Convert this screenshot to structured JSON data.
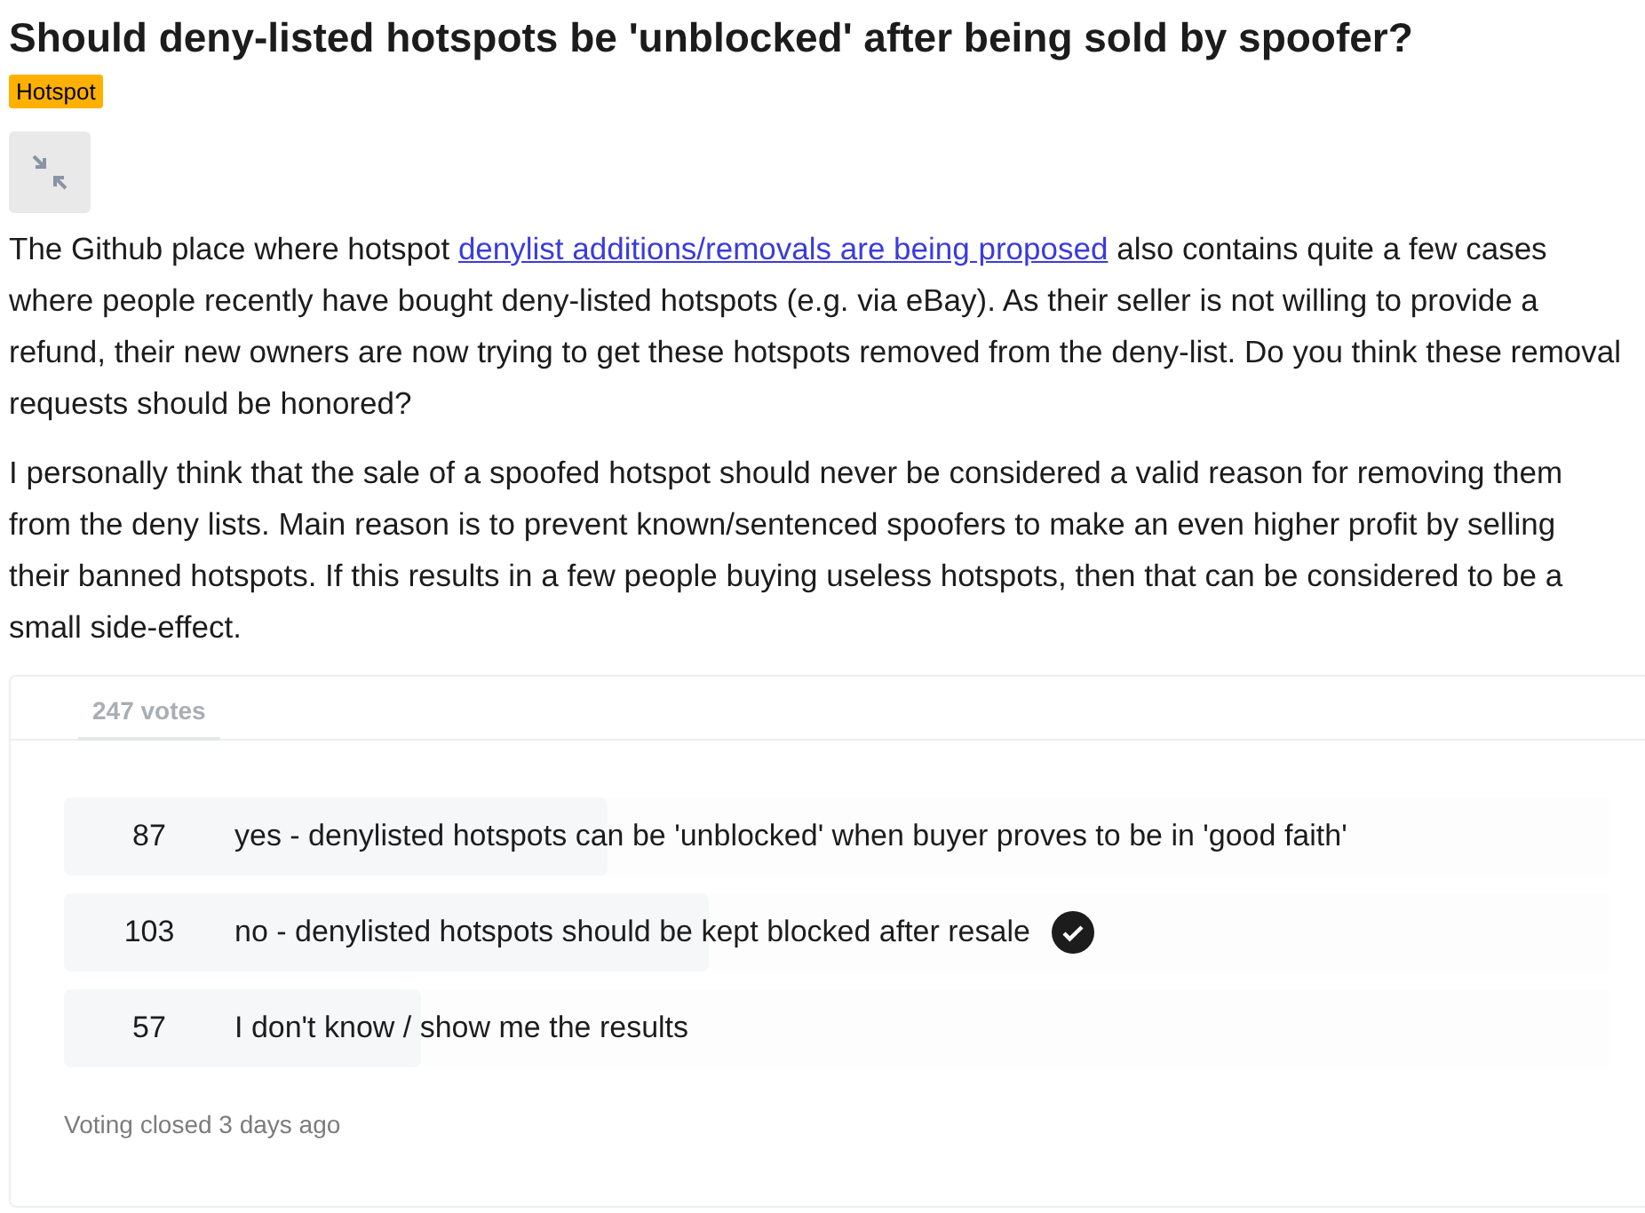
{
  "post": {
    "title": "Should deny-listed hotspots be 'unblocked' after being sold by spoofer?",
    "flair": "Hotspot",
    "paragraphs": [
      {
        "before": "The Github place where hotspot ",
        "link": "denylist additions/removals are being proposed",
        "after": " also contains quite a few cases where people recently have bought deny-listed hotspots (e.g. via eBay). As their seller is not willing to provide a refund, their new owners are now trying to get these hotspots removed from the deny-list. Do you think these removal requests should be honored?"
      },
      {
        "before": "I personally think that the sale of a spoofed hotspot should never be considered a valid reason for removing them from the deny lists. Main reason is to prevent known/sentenced spoofers to make an even higher profit by selling their banned hotspots. If this results in a few people buying useless hotspots, then that can be considered to be a small side-effect."
      }
    ]
  },
  "poll": {
    "total": "247 votes",
    "options": [
      {
        "votes": "87",
        "label": "yes - denylisted hotspots can be 'unblocked' when buyer proves to be in 'good faith'",
        "level": 0.352,
        "selected": false
      },
      {
        "votes": "103",
        "label": "no - denylisted hotspots should be kept blocked after resale",
        "level": 0.417,
        "selected": true
      },
      {
        "votes": "57",
        "label": "I don't know / show me the results",
        "level": 0.231,
        "selected": false
      }
    ],
    "status": "Voting closed 3 days ago"
  }
}
